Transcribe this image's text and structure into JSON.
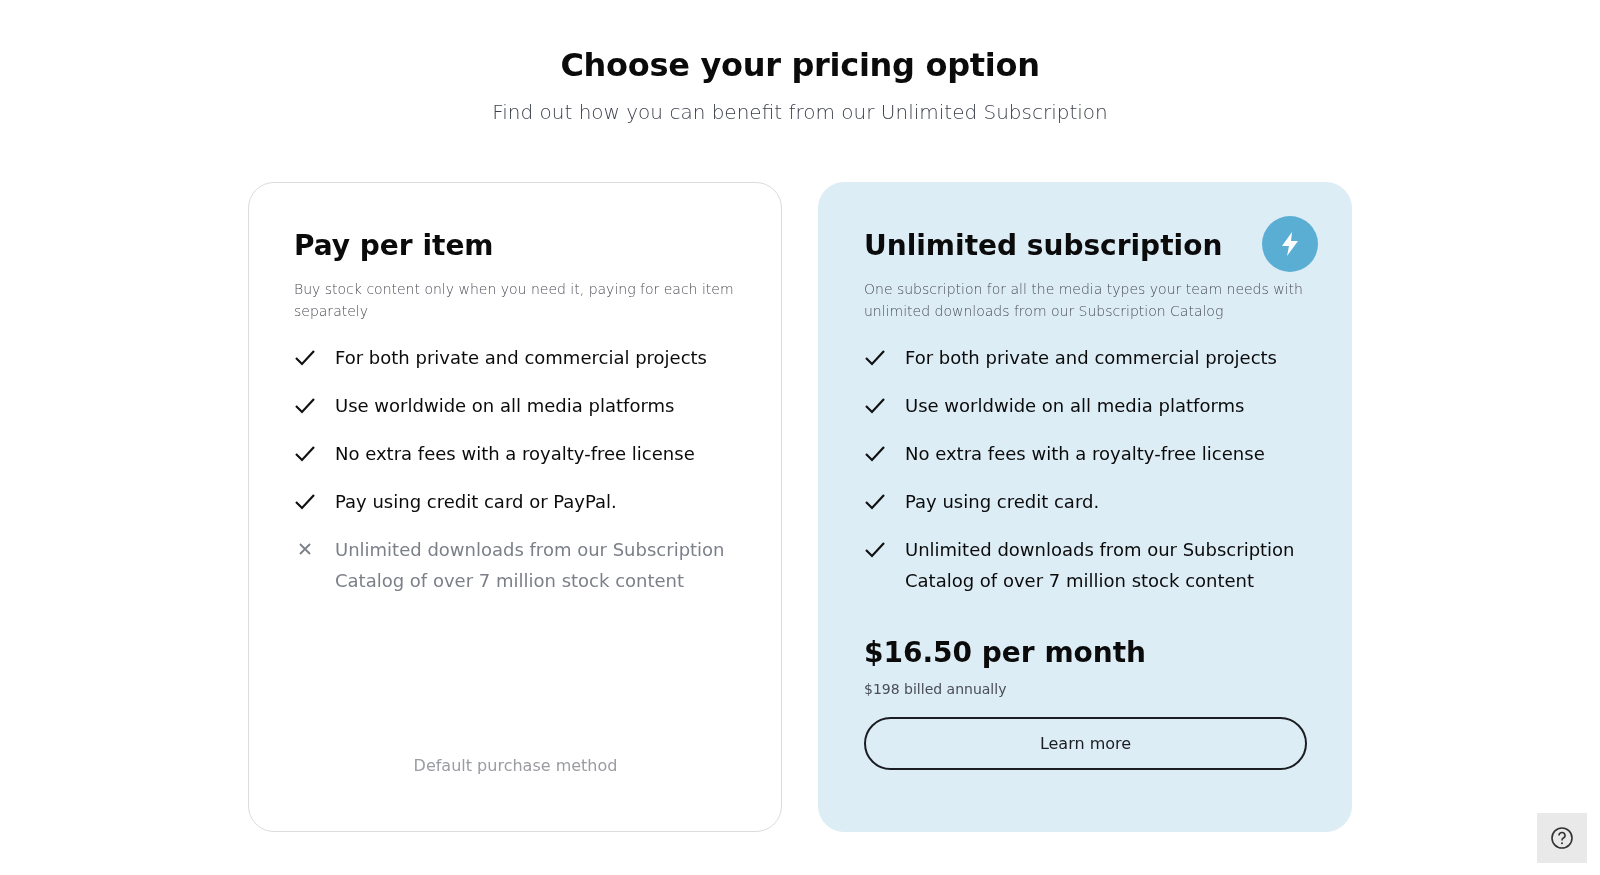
{
  "header": {
    "title": "Choose your pricing option",
    "subtitle": "Find out how you can benefit from our Unlimited Subscription"
  },
  "plans": [
    {
      "title": "Pay per item",
      "highlighted": false,
      "description": "Buy stock content only when you need it, paying for each item separately",
      "features": [
        {
          "text": "For both private and commercial projects",
          "included": true
        },
        {
          "text": "Use worldwide on all media platforms",
          "included": true
        },
        {
          "text": "No extra fees with a royalty-free license",
          "included": true
        },
        {
          "text": "Pay using credit card or PayPal.",
          "included": true
        },
        {
          "text": "Unlimited downloads from our Subscription Catalog of over 7 million stock content",
          "included": false
        }
      ],
      "footer_note": "Default purchase method"
    },
    {
      "title": "Unlimited subscription",
      "highlighted": true,
      "description": "One subscription for all the media types your team needs with unlimited downloads from our Subscription Catalog",
      "features": [
        {
          "text": "For both private and commercial projects",
          "included": true
        },
        {
          "text": "Use worldwide on all media platforms",
          "included": true
        },
        {
          "text": "No extra fees with a royalty-free license",
          "included": true
        },
        {
          "text": "Pay using credit card.",
          "included": true
        },
        {
          "text": "Unlimited downloads from our Subscription Catalog of over 7 million stock content",
          "included": true
        }
      ],
      "price": "$16.50 per month",
      "billing": "$198 billed annually",
      "button": "Learn more"
    }
  ]
}
